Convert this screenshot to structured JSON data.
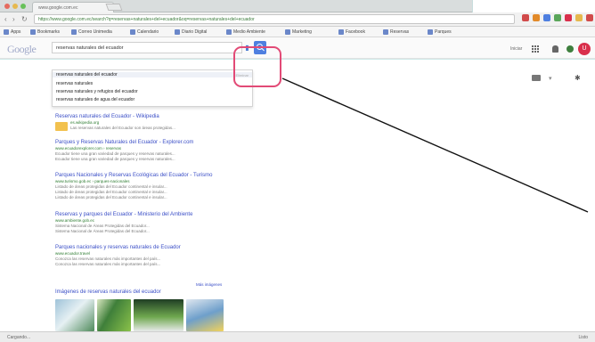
{
  "browser": {
    "tab_title": "www.google.com.ec",
    "url": "https://www.google.com.ec/search?q=reservas+naturales+del+ecuador&oq=reservas+naturales+del+ecuador",
    "bookmarks": [
      "Apps",
      "Bookmarks",
      "Correo Unimedia",
      "Calendario",
      "Diario Digital",
      "Medio Ambiente",
      "Marketing",
      "Facebook",
      "Reservas",
      "Parques"
    ]
  },
  "google": {
    "logo": "Google",
    "query": "reservas naturales del ecuador",
    "suggestions": [
      "reservas naturales del ecuador",
      "reservas naturales",
      "reservas naturales y refugios del ecuador",
      "reservas naturales de agua del ecuador"
    ],
    "suggestion_meta": "Eliminar",
    "signin_text": "Iniciar",
    "avatar_letter": "U"
  },
  "results": [
    {
      "title": "Reservas naturales del Ecuador - Wikipedia",
      "url": "es.wikipedia.org",
      "snippet": "Las reservas naturales del Ecuador son áreas protegidas..."
    },
    {
      "title": "Parques y Reservas Naturales del Ecuador - Explorer.com",
      "url": "www.ecuadorexplorer.com › reservas",
      "snippet": "Ecuador tiene una gran variedad de parques y reservas naturales..."
    },
    {
      "title": "Parques Nacionales y Reservas Ecológicas del Ecuador - Turismo",
      "url": "www.turismo.gob.ec › parques-nacionales",
      "snippet": "Listado de áreas protegidas del Ecuador continental e insular..."
    },
    {
      "title": "Reservas y parques del Ecuador - Ministerio del Ambiente",
      "url": "www.ambiente.gob.ec",
      "snippet": "Sistema Nacional de Áreas Protegidas del Ecuador..."
    },
    {
      "title": "Parques nacionales y reservas naturales de Ecuador",
      "url": "www.ecuador.travel",
      "snippet": "Conozca las reservas naturales más importantes del país..."
    }
  ],
  "images_heading": "Imágenes de reservas naturales del ecuador",
  "images_more": "Más imágenes",
  "status": {
    "left": "Cargando...",
    "right": "Listo"
  },
  "colors": {
    "accent": "#4e7fe0",
    "callout": "#e24a76",
    "link": "#3b4fc7"
  }
}
